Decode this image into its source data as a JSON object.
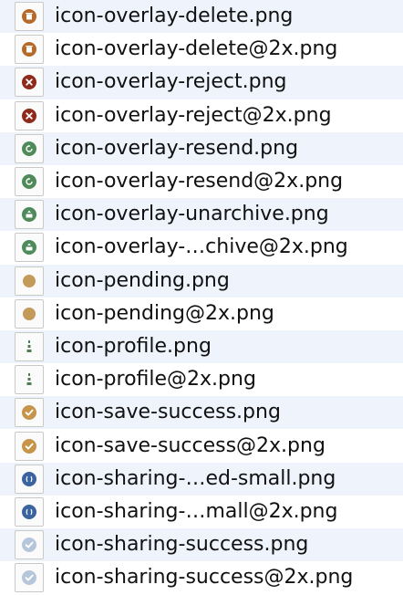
{
  "colors": {
    "row_alt_bg": "#eef3fc",
    "delete": "#b56a2c",
    "reject": "#8e2a1c",
    "resend": "#4f8a5b",
    "unarchive": "#4f8a5b",
    "pending": "#c49a5b",
    "profile": "#4f7d52",
    "save_success": "#c69549",
    "sharing": "#3a63a0",
    "sharing_success": "#b6c6da"
  },
  "files": [
    {
      "name": "icon-overlay-delete.png",
      "icon": "trash-icon",
      "color": "#b56a2c"
    },
    {
      "name": "icon-overlay-delete@2x.png",
      "icon": "trash-icon",
      "color": "#b56a2c"
    },
    {
      "name": "icon-overlay-reject.png",
      "icon": "x-circle-icon",
      "color": "#8e2a1c"
    },
    {
      "name": "icon-overlay-reject@2x.png",
      "icon": "x-circle-icon",
      "color": "#8e2a1c"
    },
    {
      "name": "icon-overlay-resend.png",
      "icon": "refresh-circle-icon",
      "color": "#4f8a5b"
    },
    {
      "name": "icon-overlay-resend@2x.png",
      "icon": "refresh-circle-icon",
      "color": "#4f8a5b"
    },
    {
      "name": "icon-overlay-unarchive.png",
      "icon": "unarchive-circle-icon",
      "color": "#4f8a5b"
    },
    {
      "name": "icon-overlay-…chive@2x.png",
      "icon": "unarchive-circle-icon",
      "color": "#4f8a5b"
    },
    {
      "name": "icon-pending.png",
      "icon": "pending-dot-icon",
      "color": "#c49a5b"
    },
    {
      "name": "icon-pending@2x.png",
      "icon": "pending-dot-icon",
      "color": "#c49a5b"
    },
    {
      "name": "icon-profile.png",
      "icon": "profile-icon",
      "color": "#4f7d52"
    },
    {
      "name": "icon-profile@2x.png",
      "icon": "profile-icon",
      "color": "#4f7d52"
    },
    {
      "name": "icon-save-success.png",
      "icon": "check-circle-icon",
      "color": "#c69549"
    },
    {
      "name": "icon-save-success@2x.png",
      "icon": "check-circle-icon",
      "color": "#c69549"
    },
    {
      "name": "icon-sharing-…ed-small.png",
      "icon": "sharing-circle-icon",
      "color": "#3a63a0"
    },
    {
      "name": "icon-sharing-…mall@2x.png",
      "icon": "sharing-circle-icon",
      "color": "#3a63a0"
    },
    {
      "name": "icon-sharing-success.png",
      "icon": "check-circle-icon",
      "color": "#b6c6da"
    },
    {
      "name": "icon-sharing-success@2x.png",
      "icon": "check-circle-icon",
      "color": "#b6c6da"
    }
  ]
}
